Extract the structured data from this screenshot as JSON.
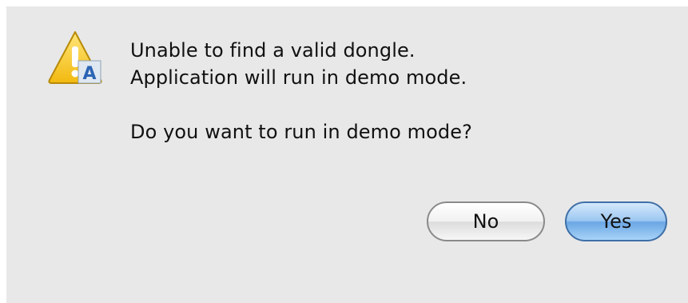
{
  "dialog": {
    "icon": "warning-triangle-icon",
    "message_lines": [
      "Unable to find a valid dongle.",
      "Application will run in demo mode."
    ],
    "question": "Do you want to run in demo mode?",
    "buttons": {
      "no_label": "No",
      "yes_label": "Yes"
    }
  },
  "colors": {
    "dialog_background": "#e8e8e8",
    "warning_yellow": "#f5c518",
    "default_button_blue": "#6aa7e4"
  }
}
